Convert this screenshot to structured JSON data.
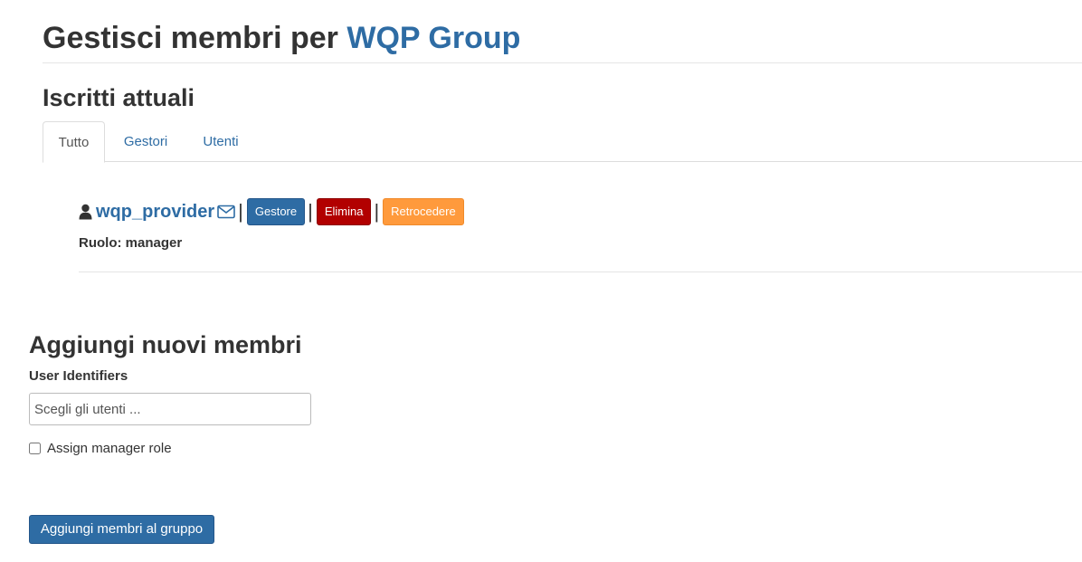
{
  "header": {
    "title_prefix": "Gestisci membri per",
    "group_name": "WQP Group"
  },
  "current_members": {
    "heading": "Iscritti attuali",
    "tabs": [
      {
        "label": "Tutto",
        "active": true
      },
      {
        "label": "Gestori",
        "active": false
      },
      {
        "label": "Utenti",
        "active": false
      }
    ],
    "members": [
      {
        "username": "wqp_provider",
        "separator": "|",
        "manager_label": "Gestore",
        "delete_label": "Elimina",
        "demote_label": "Retrocedere",
        "role_text": "Ruolo: manager"
      }
    ]
  },
  "add_members": {
    "heading": "Aggiungi nuovi membri",
    "field_label": "User Identifiers",
    "input_placeholder": "Scegli gli utenti ...",
    "input_value": "",
    "checkbox_label": "Assign manager role",
    "checkbox_checked": false,
    "submit_label": "Aggiungi membri al gruppo"
  },
  "colors": {
    "link": "#2e6ca4",
    "primary": "#2e6ca4",
    "danger": "#b20000",
    "warning": "#ff9a3c"
  },
  "icons": {
    "user": "user-icon",
    "mail": "envelope-icon"
  }
}
